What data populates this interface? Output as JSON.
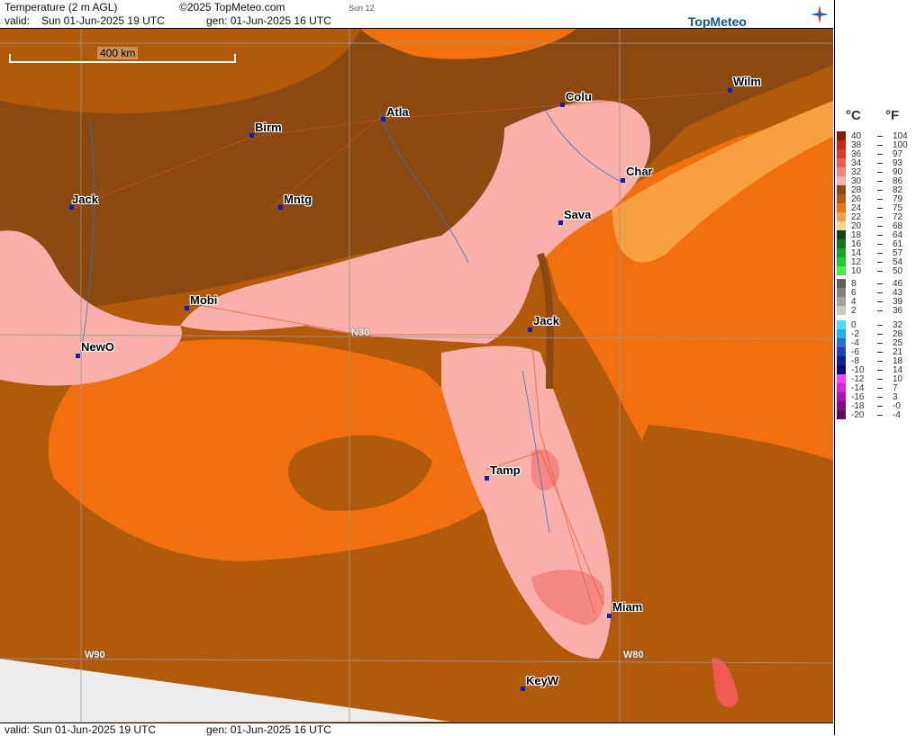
{
  "header": {
    "title": "Temperature (2 m AGL)",
    "copyright": "©2025 TopMeteo.com",
    "run_label": "Sun 12",
    "valid_prefix": "valid:",
    "valid_time": "Sun  01-Jun-2025  19 UTC",
    "gen_time": "gen: 01-Jun-2025 16 UTC",
    "logo": "TopMeteo"
  },
  "footer": {
    "valid": "valid:  Sun  01-Jun-2025  19 UTC",
    "gen": "gen: 01-Jun-2025 16 UTC"
  },
  "map": {
    "scale_label": "400 km",
    "grid_labels": {
      "n30": "N30",
      "w90": "W90",
      "w80": "W80"
    },
    "cities": [
      {
        "name": "Jack",
        "id": "jackson-ms"
      },
      {
        "name": "Birm",
        "id": "birmingham"
      },
      {
        "name": "Atla",
        "id": "atlanta"
      },
      {
        "name": "Colu",
        "id": "columbia"
      },
      {
        "name": "Wilm",
        "id": "wilmington"
      },
      {
        "name": "Char",
        "id": "charleston"
      },
      {
        "name": "Mntg",
        "id": "montgomery"
      },
      {
        "name": "Sava",
        "id": "savannah"
      },
      {
        "name": "Mobi",
        "id": "mobile"
      },
      {
        "name": "Jack",
        "id": "jacksonville"
      },
      {
        "name": "NewO",
        "id": "new-orleans"
      },
      {
        "name": "Tamp",
        "id": "tampa"
      },
      {
        "name": "Miam",
        "id": "miami"
      },
      {
        "name": "KeyW",
        "id": "key-west"
      }
    ]
  },
  "legend": {
    "unit_c": "°C",
    "unit_f": "°F",
    "rows": [
      {
        "c": "40",
        "f": "104",
        "color": "#8b1c0c"
      },
      {
        "c": "38",
        "f": "100",
        "color": "#c42a12"
      },
      {
        "c": "36",
        "f": "97",
        "color": "#e23a22"
      },
      {
        "c": "34",
        "f": "93",
        "color": "#f05a50"
      },
      {
        "c": "32",
        "f": "90",
        "color": "#f48880"
      },
      {
        "c": "30",
        "f": "86",
        "color": "#f8b0a8"
      },
      {
        "c": "28",
        "f": "82",
        "color": "#8a4a12"
      },
      {
        "c": "26",
        "f": "79",
        "color": "#b05a0a"
      },
      {
        "c": "24",
        "f": "75",
        "color": "#f07010"
      },
      {
        "c": "22",
        "f": "72",
        "color": "#f8a040"
      },
      {
        "c": "20",
        "f": "68",
        "color": "#fcd090"
      },
      {
        "c": "18",
        "f": "64",
        "color": "#0a4a14"
      },
      {
        "c": "16",
        "f": "61",
        "color": "#0e7a1e"
      },
      {
        "c": "14",
        "f": "57",
        "color": "#12a828"
      },
      {
        "c": "12",
        "f": "54",
        "color": "#20cc30"
      },
      {
        "c": "10",
        "f": "50",
        "color": "#44ee44"
      },
      {
        "c": "8",
        "f": "46",
        "color": "#606060"
      },
      {
        "c": "6",
        "f": "43",
        "color": "#808080"
      },
      {
        "c": "4",
        "f": "39",
        "color": "#a0a0a0"
      },
      {
        "c": "2",
        "f": "36",
        "color": "#c8c8c8"
      },
      {
        "c": "0",
        "f": "32",
        "color": "#40e0ff"
      },
      {
        "c": "-2",
        "f": "28",
        "color": "#20b0f0"
      },
      {
        "c": "-4",
        "f": "25",
        "color": "#2070e0"
      },
      {
        "c": "-6",
        "f": "21",
        "color": "#1a40c8"
      },
      {
        "c": "-8",
        "f": "18",
        "color": "#1020a0"
      },
      {
        "c": "-10",
        "f": "14",
        "color": "#0a0a80"
      },
      {
        "c": "-12",
        "f": "10",
        "color": "#ff40ff"
      },
      {
        "c": "-14",
        "f": "7",
        "color": "#e020e0"
      },
      {
        "c": "-16",
        "f": "3",
        "color": "#b010b0"
      },
      {
        "c": "-18",
        "f": "-0",
        "color": "#801080"
      },
      {
        "c": "-20",
        "f": "-4",
        "color": "#600a60"
      }
    ]
  },
  "colors": {
    "land_hot": "#f8b0a8",
    "land_warm": "#8a4a12",
    "sea_orange": "#f07010",
    "sea_brown": "#b05a0a",
    "atlantic_light": "#f8a040",
    "city_marker": "#1020c0"
  }
}
